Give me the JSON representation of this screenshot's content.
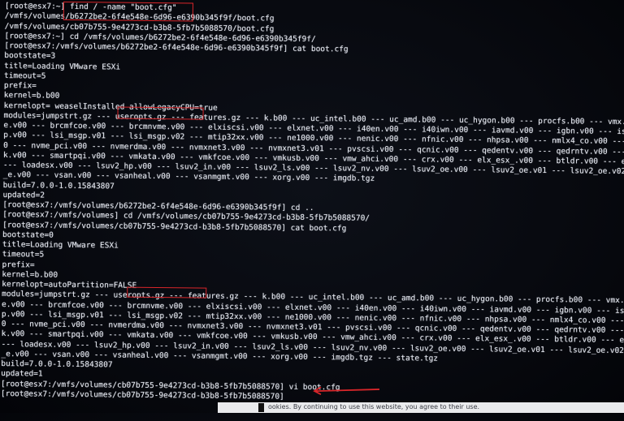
{
  "terminal": {
    "lines": [
      "[root@esx7:~] find / -name \"boot.cfg\"",
      "/vmfs/volumes/b6272be2-6f4e548e-6d96-e6390b345f9f/boot.cfg",
      "/vmfs/volumes/cb07b755-9e4273cd-b3b8-5fb7b5088570/boot.cfg",
      "[root@esx7:~] cd /vmfs/volumes/b6272be2-6f4e548e-6d96-e6390b345f9f/",
      "[root@esx7:/vmfs/volumes/b6272be2-6f4e548e-6d96-e6390b345f9f] cat boot.cfg",
      "bootstate=3",
      "title=Loading VMware ESXi",
      "timeout=5",
      "prefix=",
      "kernel=b.b00",
      "kernelopt= weaselInstalled allowLegacyCPU=true",
      "modules=jumpstrt.gz --- useropts.gz --- features.gz --- k.b00 --- uc_intel.b00 --- uc_amd.b00 --- uc_hygon.b00 --- procfs.b00 --- vmx.v00 --- vim.v00 --- tpm.v",
      "e.v00 --- brcmfcoe.v00 --- brcmnvme.v00 --- elxiscsi.v00 --- elxnet.v00 --- i40en.v00 --- i40iwn.v00 --- iavmd.v00 --- igbn.v00 --- iser.v00 --- ixgben.v00 --- l",
      "p.v00 --- lsi_msgp.v01 --- lsi_msgp.v02 --- mtip32xx.v00 --- ne1000.v00 --- nenic.v00 --- nfnic.v00 --- nhpsa.v00 --- nmlx4_co.v00 --- nmlx4_en.v00 --- nmlx4_r",
      "0 --- nvme_pci.v00 --- nvmerdma.v00 --- nvmxnet3.v00 --- nvmxnet3.v01 --- pvscsi.v00 --- qcnic.v00 --- qedentv.v00 --- qedrntv.v00 --- qfle3.v00 --- qfle3f.v00 -",
      "k.v00 --- smartpqi.v00 --- vmkata.v00 --- vmkfcoe.v00 --- vmkusb.v00 --- vmw_ahci.v00 --- crx.v00 --- elx_esx_.v00 --- btldr.v00 --- esx_dvfi.v00 --- esx_ui.v",
      "--- loadesx.v00 --- lsuv2_hp.v00 --- lsuv2_in.v00 --- lsuv2_ls.v00 --- lsuv2_nv.v00 --- lsuv2_oe.v00 --- lsuv2_oe.v01 --- lsuv2_oe.v02 --- lsuv2_sm.v00 --- nativ",
      "_e.v00 --- vsan.v00 --- vsanheal.v00 --- vsanmgmt.v00 --- xorg.v00 --- imgdb.tgz",
      "build=7.0.0-1.0.15843807",
      "updated=2",
      "[root@esx7:/vmfs/volumes/b6272be2-6f4e548e-6d96-e6390b345f9f] cd ..",
      "[root@esx7:/vmfs/volumes] cd /vmfs/volumes/cb07b755-9e4273cd-b3b8-5fb7b5088570/",
      "[root@esx7:/vmfs/volumes/cb07b755-9e4273cd-b3b8-5fb7b5088570] cat boot.cfg",
      "bootstate=0",
      "title=Loading VMware ESXi",
      "timeout=5",
      "prefix=",
      "kernel=b.b00",
      "kernelopt=autoPartition=FALSE",
      "modules=jumpstrt.gz --- useropts.gz --- features.gz --- k.b00 --- uc_intel.b00 --- uc_amd.b00 --- uc_hygon.b00 --- procfs.b00 --- vmx.v00 --- vim.v00 --- tpm.v",
      "e.v00 --- brcmfcoe.v00 --- brcmnvme.v00 --- elxiscsi.v00 --- elxnet.v00 --- i40en.v00 --- i40iwn.v00 --- iavmd.v00 --- igbn.v00 --- iser.v00 --- ixgben.v00 --- l",
      "p.v00 --- lsi_msgp.v01 --- lsi_msgp.v02 --- mtip32xx.v00 --- ne1000.v00 --- nenic.v00 --- nfnic.v00 --- nhpsa.v00 --- nmlx4_co.v00 --- nmlx4_en.v00 --- nmlx4_rd.",
      "0 --- nvme_pci.v00 --- nvmerdma.v00 --- nvmxnet3.v00 --- nvmxnet3.v01 --- pvscsi.v00 --- qcnic.v00 --- qedentv.v00 --- qedrntv.v00 --- qfle3.v00 --- qfle3f.v00 -",
      "k.v00 --- smartpqi.v00 --- vmkata.v00 --- vmkfcoe.v00 --- vmkusb.v00 --- vmw_ahci.v00 --- crx.v00 --- elx_esx_.v00 --- btldr.v00 --- esx_dvfi.v00 --- esx_ui.v",
      "--- loadesx.v00 --- lsuv2_hp.v00 --- lsuv2_in.v00 --- lsuv2_ls.v00 --- lsuv2_nv.v00 --- lsuv2_oe.v00 --- lsuv2_oe.v01 --- lsuv2_oe.v02 --- lsuv2_sm.v00 --- nativ",
      "_e.v00 --- vsan.v00 --- vsanheal.v00 --- vsanmgmt.v00 --- xorg.v00 --- imgdb.tgz --- state.tgz",
      "build=7.0.0-1.0.15843807",
      "updated=1",
      "[root@esx7:/vmfs/volumes/cb07b755-9e4273cd-b3b8-5fb7b5088570] vi boot.cfg",
      "[root@esx7:/vmfs/volumes/cb07b755-9e4273cd-b3b8-5fb7b5088570]"
    ]
  },
  "overlay": {
    "cookie_text": "ookies. By continuing to use this website, you agree to their use."
  },
  "colors": {
    "terminal_text": "#e4e7ee",
    "highlight": "#d8262a",
    "background": "#080a10"
  }
}
